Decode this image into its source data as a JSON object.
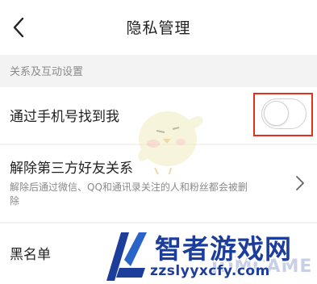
{
  "header": {
    "title": "隐私管理",
    "back_icon": "chevron-left-icon"
  },
  "section": {
    "title": "关系及互动设置"
  },
  "rows": {
    "find_me": {
      "label": "通过手机号找到我",
      "toggle_on": false,
      "highlight_color": "#e0301e"
    },
    "unlink": {
      "label": "解除第三方好友关系",
      "description": "解除后通过微信、QQ和通讯录关注的人和粉丝都会被删除",
      "chevron_icon": "chevron-right-icon"
    },
    "blacklist": {
      "label": "黑名单"
    }
  },
  "watermark": {
    "logo_text": "智者游戏网",
    "url": "zzslyyxcfy.com",
    "faint_text": "JDMCAME",
    "brand_color": "#1d3d9a"
  }
}
